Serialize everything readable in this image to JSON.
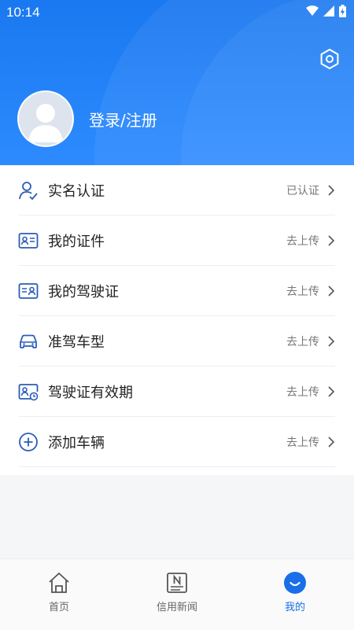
{
  "status_bar": {
    "time": "10:14"
  },
  "profile": {
    "login_label": "登录/注册"
  },
  "menu": [
    {
      "label": "实名认证",
      "status": "已认证",
      "icon": "user-verified-icon"
    },
    {
      "label": "我的证件",
      "status": "去上传",
      "icon": "id-card-icon"
    },
    {
      "label": "我的驾驶证",
      "status": "去上传",
      "icon": "driver-license-icon"
    },
    {
      "label": "准驾车型",
      "status": "去上传",
      "icon": "car-icon"
    },
    {
      "label": "驾驶证有效期",
      "status": "去上传",
      "icon": "license-expiry-icon"
    },
    {
      "label": "添加车辆",
      "status": "去上传",
      "icon": "add-circle-icon"
    }
  ],
  "tabs": [
    {
      "label": "首页",
      "icon": "home-icon"
    },
    {
      "label": "信用新闻",
      "icon": "news-icon"
    },
    {
      "label": "我的",
      "icon": "profile-icon",
      "active": true
    }
  ],
  "colors": {
    "primary": "#1a78f0",
    "active_tab": "#1a6fe8"
  }
}
